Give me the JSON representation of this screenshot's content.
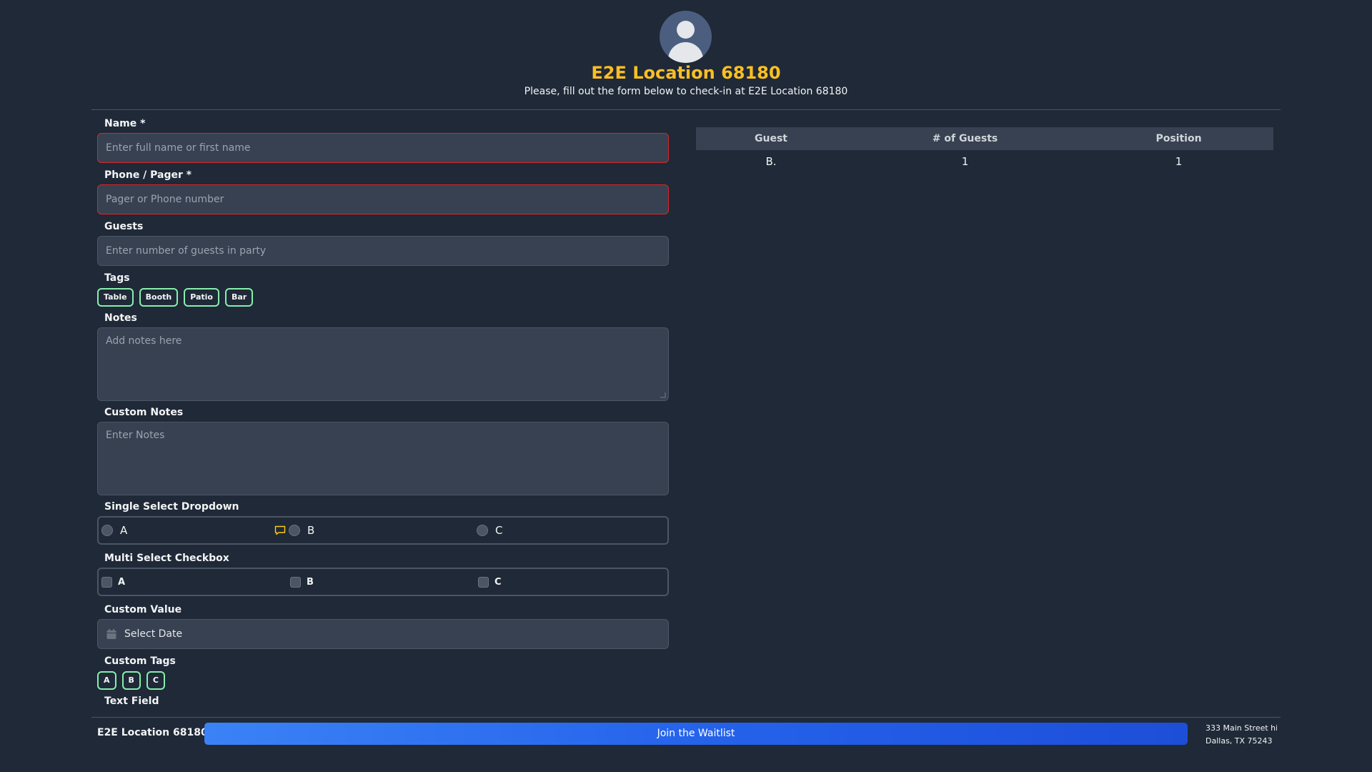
{
  "header": {
    "title": "E2E Location 68180",
    "subtitle": "Please, fill out the form below to check-in at E2E Location 68180"
  },
  "form": {
    "name": {
      "label": "Name *",
      "placeholder": "Enter full name or first name"
    },
    "phone": {
      "label": "Phone / Pager *",
      "placeholder": "Pager or Phone number"
    },
    "guests": {
      "label": "Guests",
      "placeholder": "Enter number of guests in party"
    },
    "tags": {
      "label": "Tags",
      "items": [
        "Table",
        "Booth",
        "Patio",
        "Bar"
      ]
    },
    "notes": {
      "label": "Notes",
      "placeholder": "Add notes here"
    },
    "custom_notes": {
      "label": "Custom Notes",
      "placeholder": "Enter Notes"
    },
    "single_select": {
      "label": "Single Select Dropdown",
      "options": [
        "A",
        "B",
        "C"
      ]
    },
    "multi_select": {
      "label": "Multi Select Checkbox",
      "options": [
        "A",
        "B",
        "C"
      ]
    },
    "custom_value": {
      "label": "Custom Value",
      "placeholder": "Select Date"
    },
    "custom_tags": {
      "label": "Custom Tags",
      "items": [
        "A",
        "B",
        "C"
      ]
    },
    "text_field": {
      "label": "Text Field"
    }
  },
  "waitlist": {
    "columns": [
      "Guest",
      "# of Guests",
      "Position"
    ],
    "rows": [
      [
        "B.",
        "1",
        "1"
      ]
    ]
  },
  "footer": {
    "location_name": "E2E Location 68180",
    "join_button": "Join the Waitlist",
    "address_line1": "333 Main Street hi",
    "address_line2": "Dallas, TX 75243"
  },
  "colors": {
    "background": "#1f2937",
    "title": "#fbbf24",
    "error_border": "#dc2626",
    "tag_border": "#86efac",
    "button": "#2563eb"
  }
}
